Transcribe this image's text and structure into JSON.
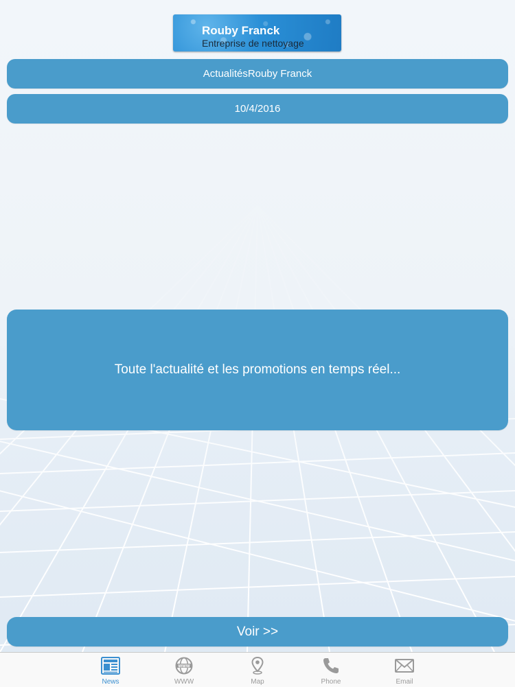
{
  "header": {
    "logo_title": "Rouby Franck",
    "logo_subtitle": "Entreprise de nettoyage"
  },
  "news": {
    "heading": "ActualitésRouby Franck",
    "date": "10/4/2016",
    "body": "Toute l'actualité et les promotions en temps réel...",
    "action_label": "Voir >>"
  },
  "tabbar": {
    "active_tab": "News",
    "tabs": [
      {
        "label": "News",
        "icon": "newspaper-icon"
      },
      {
        "label": "WWW",
        "icon": "globe-icon"
      },
      {
        "label": "Map",
        "icon": "map-pin-icon"
      },
      {
        "label": "Phone",
        "icon": "phone-icon"
      },
      {
        "label": "Email",
        "icon": "envelope-icon"
      }
    ]
  },
  "colors": {
    "accent": "#4a9ccb",
    "active_tab": "#3a8fd0",
    "inactive_tab": "#9a9a9a"
  }
}
